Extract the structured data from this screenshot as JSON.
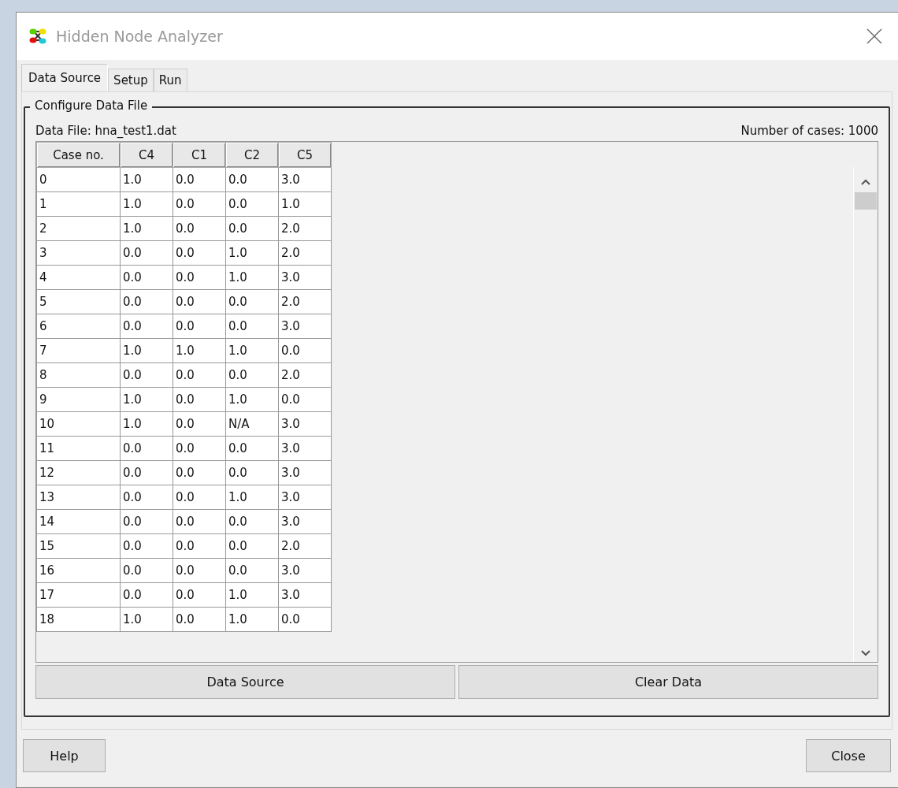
{
  "window": {
    "title": "Hidden Node Analyzer"
  },
  "tabs": [
    {
      "label": "Data Source",
      "selected": true
    },
    {
      "label": "Setup",
      "selected": false
    },
    {
      "label": "Run",
      "selected": false
    }
  ],
  "panel": {
    "title": "Configure Data File",
    "data_file": "Data File: hna_test1.dat",
    "case_count": "Number of cases: 1000"
  },
  "table": {
    "columns": [
      "Case no.",
      "C4",
      "C1",
      "C2",
      "C5"
    ],
    "rows": [
      [
        "0",
        "1.0",
        "0.0",
        "0.0",
        "3.0"
      ],
      [
        "1",
        "1.0",
        "0.0",
        "0.0",
        "1.0"
      ],
      [
        "2",
        "1.0",
        "0.0",
        "0.0",
        "2.0"
      ],
      [
        "3",
        "0.0",
        "0.0",
        "1.0",
        "2.0"
      ],
      [
        "4",
        "0.0",
        "0.0",
        "1.0",
        "3.0"
      ],
      [
        "5",
        "0.0",
        "0.0",
        "0.0",
        "2.0"
      ],
      [
        "6",
        "0.0",
        "0.0",
        "0.0",
        "3.0"
      ],
      [
        "7",
        "1.0",
        "1.0",
        "1.0",
        "0.0"
      ],
      [
        "8",
        "0.0",
        "0.0",
        "0.0",
        "2.0"
      ],
      [
        "9",
        "1.0",
        "0.0",
        "1.0",
        "0.0"
      ],
      [
        "10",
        "1.0",
        "0.0",
        "N/A",
        "3.0"
      ],
      [
        "11",
        "0.0",
        "0.0",
        "0.0",
        "3.0"
      ],
      [
        "12",
        "0.0",
        "0.0",
        "0.0",
        "3.0"
      ],
      [
        "13",
        "0.0",
        "0.0",
        "1.0",
        "3.0"
      ],
      [
        "14",
        "0.0",
        "0.0",
        "0.0",
        "3.0"
      ],
      [
        "15",
        "0.0",
        "0.0",
        "0.0",
        "2.0"
      ],
      [
        "16",
        "0.0",
        "0.0",
        "0.0",
        "3.0"
      ],
      [
        "17",
        "0.0",
        "0.0",
        "1.0",
        "3.0"
      ],
      [
        "18",
        "1.0",
        "0.0",
        "1.0",
        "0.0"
      ]
    ]
  },
  "panel_buttons": [
    "Data Source",
    "Clear Data"
  ],
  "footer_buttons": [
    "Help",
    "Close"
  ]
}
